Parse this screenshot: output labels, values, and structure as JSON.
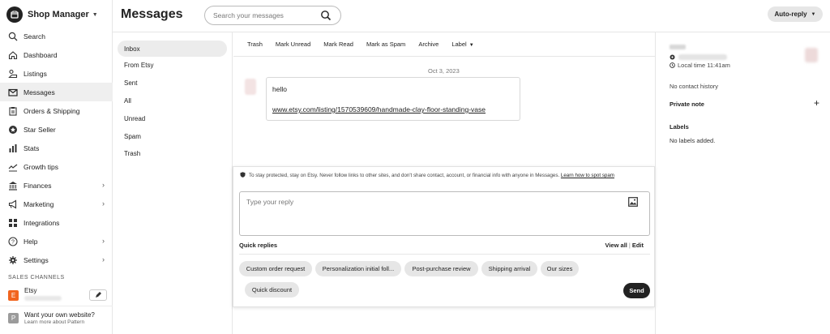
{
  "brand": {
    "name": "Shop Manager"
  },
  "nav": {
    "items": [
      {
        "label": "Search",
        "icon": "search-icon",
        "active": false
      },
      {
        "label": "Dashboard",
        "icon": "home-icon",
        "active": false
      },
      {
        "label": "Listings",
        "icon": "listings-icon",
        "active": false
      },
      {
        "label": "Messages",
        "icon": "mail-icon",
        "active": true
      },
      {
        "label": "Orders & Shipping",
        "icon": "clipboard-icon",
        "active": false
      },
      {
        "label": "Star Seller",
        "icon": "star-badge-icon",
        "active": false
      },
      {
        "label": "Stats",
        "icon": "bar-chart-icon",
        "active": false
      },
      {
        "label": "Growth tips",
        "icon": "trend-icon",
        "active": false
      },
      {
        "label": "Finances",
        "icon": "bank-icon",
        "active": false,
        "chevron": true
      },
      {
        "label": "Marketing",
        "icon": "megaphone-icon",
        "active": false,
        "chevron": true
      },
      {
        "label": "Integrations",
        "icon": "grid-icon",
        "active": false
      },
      {
        "label": "Help",
        "icon": "help-icon",
        "active": false,
        "chevron": true
      },
      {
        "label": "Settings",
        "icon": "gear-icon",
        "active": false,
        "chevron": true
      }
    ],
    "sales_channels_heading": "SALES CHANNELS",
    "etsy": {
      "badge": "E",
      "name": "Etsy"
    },
    "pattern": {
      "badge": "P",
      "title": "Want your own website?",
      "subtitle": "Learn more about Pattern"
    }
  },
  "header": {
    "title": "Messages",
    "search_placeholder": "Search your messages",
    "auto_reply": "Auto-reply"
  },
  "folders": [
    "Inbox",
    "From Etsy",
    "Sent",
    "All",
    "Unread",
    "Spam",
    "Trash"
  ],
  "toolbar": {
    "trash": "Trash",
    "mark_unread": "Mark Unread",
    "mark_read": "Mark Read",
    "mark_spam": "Mark as Spam",
    "archive": "Archive",
    "label": "Label"
  },
  "conversation": {
    "date": "Oct 3, 2023",
    "message_text": "hello",
    "message_link": "www.etsy.com/listing/1570539609/handmade-clay-floor-standing-vase"
  },
  "composer": {
    "warning": "To stay protected, stay on Etsy. Never follow links to other sites, and don't share contact, account, or financial info with anyone in Messages.",
    "warning_link": "Learn how to spot spam",
    "reply_placeholder": "Type your reply",
    "quick_replies_label": "Quick replies",
    "view_all": "View all",
    "edit": "Edit",
    "chips": [
      "Custom order request",
      "Personalization initial foll...",
      "Post-purchase review",
      "Shipping arrival",
      "Our sizes",
      "Quick discount"
    ],
    "send": "Send"
  },
  "details": {
    "local_time": "Local time 11:41am",
    "no_history": "No contact history",
    "private_note": "Private note",
    "labels_heading": "Labels",
    "no_labels": "No labels added."
  },
  "colors": {
    "etsy_orange": "#f1641e",
    "active_bg": "#efefef",
    "send_bg": "#222222"
  }
}
